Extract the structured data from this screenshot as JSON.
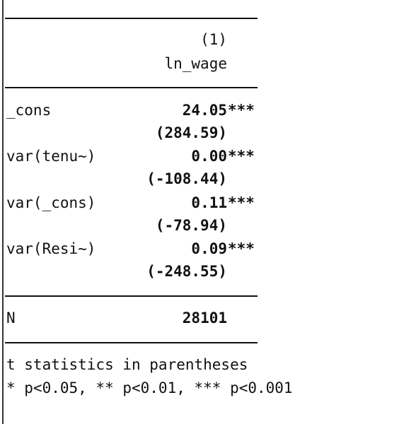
{
  "table": {
    "column_number": "(1)",
    "column_name": "ln_wage",
    "rows": [
      {
        "label": "_cons",
        "coef": "24.05",
        "stars": "***",
        "tstat": "(284.59)"
      },
      {
        "label": "var(tenu~)",
        "coef": "0.00",
        "stars": "***",
        "tstat": "(-108.44)"
      },
      {
        "label": "var(_cons)",
        "coef": "0.11",
        "stars": "***",
        "tstat": "(-78.94)"
      },
      {
        "label": "var(Resi~)",
        "coef": "0.09",
        "stars": "***",
        "tstat": "(-248.55)"
      }
    ],
    "n_label": "N",
    "n_value": "28101",
    "footnote_1": "t statistics in parentheses",
    "footnote_2": "* p<0.05, ** p<0.01, *** p<0.001"
  }
}
